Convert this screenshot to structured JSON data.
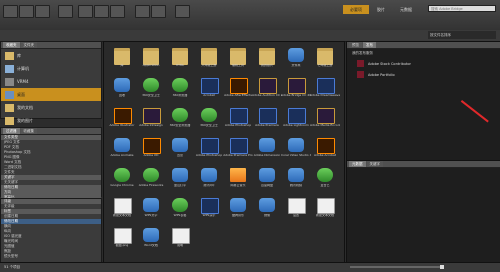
{
  "toolbar": {
    "essentials": "必要项",
    "film": "胶片",
    "metadata": "元数据",
    "search_placeholder": "搜索 Adobe Bridge",
    "sort": "按文件名排序"
  },
  "left": {
    "tabs": [
      "收藏夹",
      "文件夹"
    ],
    "favorites": [
      {
        "label": "库",
        "icon": "folder"
      },
      {
        "label": "计算机",
        "icon": "computer"
      },
      {
        "label": "VRM4",
        "icon": "drive"
      },
      {
        "label": "桌面",
        "icon": "desktop",
        "selected": true
      },
      {
        "label": "我的文档",
        "icon": "folder"
      },
      {
        "label": "我的图片",
        "icon": "folder"
      }
    ],
    "filter_tabs": [
      "过滤器",
      "收藏集"
    ],
    "filter_items": [
      {
        "label": "文件类型",
        "header": true
      },
      {
        "label": "JPEG 文件"
      },
      {
        "label": "PDF 文档"
      },
      {
        "label": "Photoshop 文档"
      },
      {
        "label": "PNG 图像"
      },
      {
        "label": "Word 文档"
      },
      {
        "label": "二进制文档"
      },
      {
        "label": "文件夹"
      },
      {
        "label": "关键字",
        "header": true
      },
      {
        "label": "无关键字"
      },
      {
        "label": "修改日期",
        "header": true
      },
      {
        "label": "方向",
        "header": true
      },
      {
        "label": "宽高比",
        "header": true
      }
    ],
    "filter_items2": [
      {
        "label": "评级",
        "header": true
      },
      {
        "label": "无评级"
      },
      {
        "label": "标签",
        "header": true
      },
      {
        "label": "创建日期"
      },
      {
        "label": "修改日期",
        "selected": true
      },
      {
        "label": "横向"
      },
      {
        "label": "纵向"
      },
      {
        "label": "ISO 感光度"
      },
      {
        "label": "曝光时间"
      },
      {
        "label": "光圈值"
      },
      {
        "label": "焦距"
      },
      {
        "label": "镜头型号"
      }
    ]
  },
  "content": {
    "items": [
      {
        "label": "库",
        "type": "folder"
      },
      {
        "label": "Application",
        "type": "folder"
      },
      {
        "label": "HTML",
        "type": "folder"
      },
      {
        "label": "八年级上册",
        "type": "folder"
      },
      {
        "label": "编辑工具",
        "type": "folder"
      },
      {
        "label": "我的照片",
        "type": "folder"
      },
      {
        "label": "文件夹",
        "type": "app"
      },
      {
        "label": "七年级上册",
        "type": "folder"
      },
      {
        "label": "回收",
        "type": "app"
      },
      {
        "label": "360安全卫士",
        "type": "green"
      },
      {
        "label": "360浏览器",
        "type": "green"
      },
      {
        "label": "Acrobat",
        "type": "psd"
      },
      {
        "label": "Adobe AfterEffects",
        "type": "ai"
      },
      {
        "label": "Adobe Audition CC 2018",
        "type": "br"
      },
      {
        "label": "Adobe Bridge CC 2018",
        "type": "br"
      },
      {
        "label": "Adobe Dreamweaver CC",
        "type": "psd"
      },
      {
        "label": "Adobe Illustrator",
        "type": "ai"
      },
      {
        "label": "Adobe InDesign",
        "type": "br"
      },
      {
        "label": "360安全浏览器",
        "type": "green"
      },
      {
        "label": "360安全卫士",
        "type": "green"
      },
      {
        "label": "Adobe Photoshop",
        "type": "psd"
      },
      {
        "label": "Adobe Premiere",
        "type": "psd"
      },
      {
        "label": "Adobe Lightroom",
        "type": "psd"
      },
      {
        "label": "Adobe Media Encoder",
        "type": "br"
      },
      {
        "label": "Adobe Animate",
        "type": "app"
      },
      {
        "label": "Adobe XD",
        "type": "ai"
      },
      {
        "label": "迅雷",
        "type": "app"
      },
      {
        "label": "Adobe Photoshop",
        "type": "psd"
      },
      {
        "label": "Adobe Premiere Pro",
        "type": "psd"
      },
      {
        "label": "Adobe Dimension",
        "type": "app"
      },
      {
        "label": "Corel Video Studio X10",
        "type": "app"
      },
      {
        "label": "Adobe Acrobat",
        "type": "ai"
      },
      {
        "label": "Google Chrome",
        "type": "green"
      },
      {
        "label": "Adobe Fireworks",
        "type": "green"
      },
      {
        "label": "金山打字",
        "type": "app"
      },
      {
        "label": "腾讯QQ",
        "type": "app"
      },
      {
        "label": "网易云音乐",
        "type": "orange"
      },
      {
        "label": "百度网盘",
        "type": "app"
      },
      {
        "label": "腾讯视频",
        "type": "app"
      },
      {
        "label": "爱奇艺",
        "type": "green"
      },
      {
        "label": "新建文本文档",
        "type": "docthumb"
      },
      {
        "label": "WPS文字",
        "type": "app"
      },
      {
        "label": "WPS表格",
        "type": "green"
      },
      {
        "label": "WPS演示",
        "type": "psd"
      },
      {
        "label": "酷狗音乐",
        "type": "app"
      },
      {
        "label": "微信",
        "type": "app"
      },
      {
        "label": "设置",
        "type": "docthumb"
      },
      {
        "label": "新建文本文档",
        "type": "docthumb"
      },
      {
        "label": "截图.png",
        "type": "docthumb"
      },
      {
        "label": "Word文档",
        "type": "app"
      },
      {
        "label": "说明",
        "type": "docthumb"
      }
    ]
  },
  "right": {
    "tabs": [
      "预览",
      "发布"
    ],
    "section_title": "我的发布服务",
    "services": [
      "Adobe Stock Contributor",
      "Adobe Portfolio"
    ],
    "tabs2": [
      "元数据",
      "关键字"
    ]
  },
  "status": {
    "count": "51 个项目"
  },
  "colors": {
    "accent": "#c9901e",
    "selection": "#3d5f86"
  }
}
